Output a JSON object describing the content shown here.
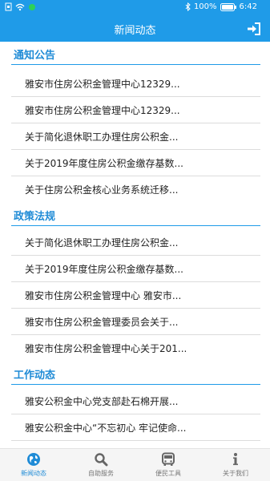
{
  "status_bar": {
    "battery": "100%",
    "time": "6:42"
  },
  "app_bar": {
    "title": "新闻动态",
    "exit_icon": "exit-icon"
  },
  "sections": [
    {
      "title": "通知公告",
      "items": [
        "雅安市住房公积金管理中心12329...",
        "雅安市住房公积金管理中心12329...",
        "关于简化退休职工办理住房公积金...",
        "关于2019年度住房公积金缴存基数...",
        "关于住房公积金核心业务系统迁移..."
      ]
    },
    {
      "title": "政策法规",
      "items": [
        "关于简化退休职工办理住房公积金...",
        "关于2019年度住房公积金缴存基数...",
        "雅安市住房公积金管理中心 雅安市...",
        "雅安市住房公积金管理委员会关于...",
        "雅安市住房公积金管理中心关于201..."
      ]
    },
    {
      "title": "工作动态",
      "items": [
        "雅安公积金中心党支部赴石棉开展...",
        "雅安公积金中心“不忘初心 牢记使命..."
      ]
    }
  ],
  "bottom_nav": [
    {
      "label": "新闻动态",
      "icon": "globe-icon",
      "active": true
    },
    {
      "label": "自助服务",
      "icon": "search-icon",
      "active": false
    },
    {
      "label": "便民工具",
      "icon": "bus-icon",
      "active": false
    },
    {
      "label": "关于我们",
      "icon": "info-icon",
      "active": false
    }
  ],
  "colors": {
    "accent": "#1f9be8",
    "section_title": "#1f8bd6"
  }
}
